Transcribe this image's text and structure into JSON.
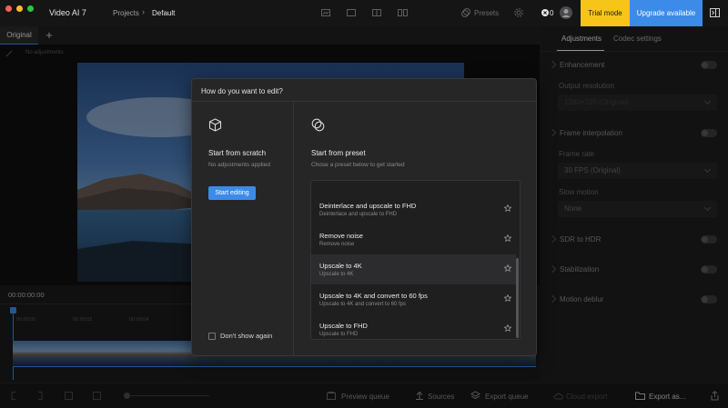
{
  "app": {
    "title": "Video AI 7",
    "breadcrumb": [
      "Projects",
      "Default"
    ],
    "presets_label": "Presets",
    "credits": "0",
    "trial_label": "Trial mode",
    "upgrade_label": "Upgrade available"
  },
  "tabs": {
    "original": "Original"
  },
  "viewer": {
    "no_adjustments": "No adjustments"
  },
  "timeline": {
    "timecode": "00:00:00:00",
    "ticks": [
      "00:00:00",
      "00:00:02",
      "00:00:04"
    ]
  },
  "bottom": {
    "preview_queue": "Preview queue",
    "sources": "Sources",
    "export_queue": "Export queue",
    "cloud_export": "Cloud export",
    "export_as": "Export as..."
  },
  "right_panel": {
    "tabs": [
      "Adjustments",
      "Codec settings"
    ],
    "enhancement": "Enhancement",
    "output_resolution_label": "Output resolution",
    "output_resolution_value": "1280×720 (Original)",
    "frame_interpolation": "Frame interpolation",
    "frame_rate_label": "Frame rate",
    "frame_rate_value": "30 FPS (Original)",
    "slow_motion_label": "Slow motion",
    "slow_motion_value": "None",
    "sdr_to_hdr": "SDR to HDR",
    "stabilization": "Stabilization",
    "motion_deblur": "Motion deblur"
  },
  "modal": {
    "title": "How do you want to edit?",
    "scratch": {
      "heading": "Start from scratch",
      "subtitle": "No adjustments applied",
      "button": "Start editing"
    },
    "preset": {
      "heading": "Start from preset",
      "subtitle": "Chose a preset below to get started"
    },
    "presets": [
      {
        "name": "Deinterlace and upscale to FHD",
        "desc": "Deinterlace and upscale to FHD"
      },
      {
        "name": "Remove noise",
        "desc": "Remove noise"
      },
      {
        "name": "Upscale to 4K",
        "desc": "Upscale to 4K"
      },
      {
        "name": "Upscale to 4K and convert to 60 fps",
        "desc": "Upscale to 4K and convert to 60 fps"
      },
      {
        "name": "Upscale to FHD",
        "desc": "Upscale to FHD"
      }
    ],
    "dont_show_again": "Don't show again"
  },
  "colors": {
    "accent": "#3c8be8",
    "trial": "#f5c518",
    "background": "#1b1b1c"
  }
}
